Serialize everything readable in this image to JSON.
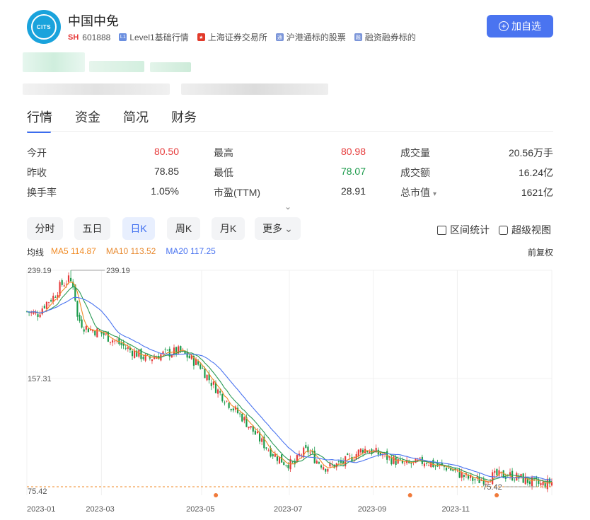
{
  "stock": {
    "name": "中国中免",
    "exchange_code": "SH",
    "code": "601888",
    "logo_text": "CITS"
  },
  "tags": [
    "Level1基础行情",
    "上海证券交易所",
    "沪港通标的股票",
    "融资融券标的"
  ],
  "add_button_label": "加自选",
  "tabs": [
    "行情",
    "资金",
    "简况",
    "财务"
  ],
  "stats": [
    [
      {
        "label": "今开",
        "value": "80.50",
        "tone": "red"
      },
      {
        "label": "最高",
        "value": "80.98",
        "tone": "red"
      },
      {
        "label": "成交量",
        "value": "20.56万手",
        "tone": ""
      }
    ],
    [
      {
        "label": "昨收",
        "value": "78.85",
        "tone": ""
      },
      {
        "label": "最低",
        "value": "78.07",
        "tone": "green"
      },
      {
        "label": "成交额",
        "value": "16.24亿",
        "tone": ""
      }
    ],
    [
      {
        "label": "换手率",
        "value": "1.05%",
        "tone": ""
      },
      {
        "label": "市盈(TTM)",
        "value": "28.91",
        "tone": ""
      },
      {
        "label": "总市值",
        "value": "1621亿",
        "tone": "",
        "caret": "▾"
      }
    ]
  ],
  "expand_glyph": "⌄",
  "periods": [
    "分时",
    "五日",
    "日K",
    "周K",
    "月K",
    "更多"
  ],
  "active_period": "日K",
  "more_caret": "⌄",
  "tools": {
    "range_stats": "区间统计",
    "super_view": "超级视图"
  },
  "ma": {
    "label": "均线",
    "ma5": "MA5 114.87",
    "ma10": "MA10 113.52",
    "ma20": "MA20 117.25",
    "adjust": "前复权"
  },
  "colors": {
    "up": "#e63a3a",
    "down": "#1a9a4a",
    "ma5": "#f08a24",
    "ma20": "#4a74f0",
    "accent": "#4a74f0"
  },
  "chart_data": {
    "type": "candlestick",
    "y_labels": [
      "239.19",
      "157.31",
      "75.42"
    ],
    "max_marker": "239.19",
    "min_marker": "75.42",
    "ylim": [
      75.42,
      239.19
    ],
    "x_ticks": [
      "2023-01",
      "2023-03",
      "2023-05",
      "2023-07",
      "2023-09",
      "2023-11"
    ],
    "event_markers": [
      0.36,
      0.73,
      0.895
    ],
    "price_path": [
      [
        0,
        208
      ],
      [
        0.02,
        206
      ],
      [
        0.035,
        214
      ],
      [
        0.05,
        219
      ],
      [
        0.065,
        228
      ],
      [
        0.08,
        232
      ],
      [
        0.09,
        228
      ],
      [
        0.095,
        204
      ],
      [
        0.11,
        196
      ],
      [
        0.14,
        192
      ],
      [
        0.17,
        185
      ],
      [
        0.2,
        178
      ],
      [
        0.23,
        172
      ],
      [
        0.26,
        176
      ],
      [
        0.29,
        178
      ],
      [
        0.31,
        173
      ],
      [
        0.33,
        167
      ],
      [
        0.35,
        155
      ],
      [
        0.37,
        145
      ],
      [
        0.39,
        136
      ],
      [
        0.41,
        128
      ],
      [
        0.43,
        118
      ],
      [
        0.45,
        108
      ],
      [
        0.47,
        100
      ],
      [
        0.49,
        94
      ],
      [
        0.51,
        92
      ],
      [
        0.52,
        100
      ],
      [
        0.535,
        103
      ],
      [
        0.55,
        96
      ],
      [
        0.57,
        90
      ],
      [
        0.6,
        93
      ],
      [
        0.62,
        98
      ],
      [
        0.64,
        104
      ],
      [
        0.66,
        102
      ],
      [
        0.69,
        97
      ],
      [
        0.72,
        92
      ],
      [
        0.74,
        93
      ],
      [
        0.76,
        95
      ],
      [
        0.78,
        91
      ],
      [
        0.8,
        90
      ],
      [
        0.82,
        86
      ],
      [
        0.84,
        82
      ],
      [
        0.86,
        80
      ],
      [
        0.88,
        83
      ],
      [
        0.9,
        84
      ],
      [
        0.92,
        84
      ],
      [
        0.94,
        82
      ],
      [
        0.96,
        79
      ],
      [
        0.98,
        77
      ],
      [
        1,
        79
      ]
    ]
  }
}
